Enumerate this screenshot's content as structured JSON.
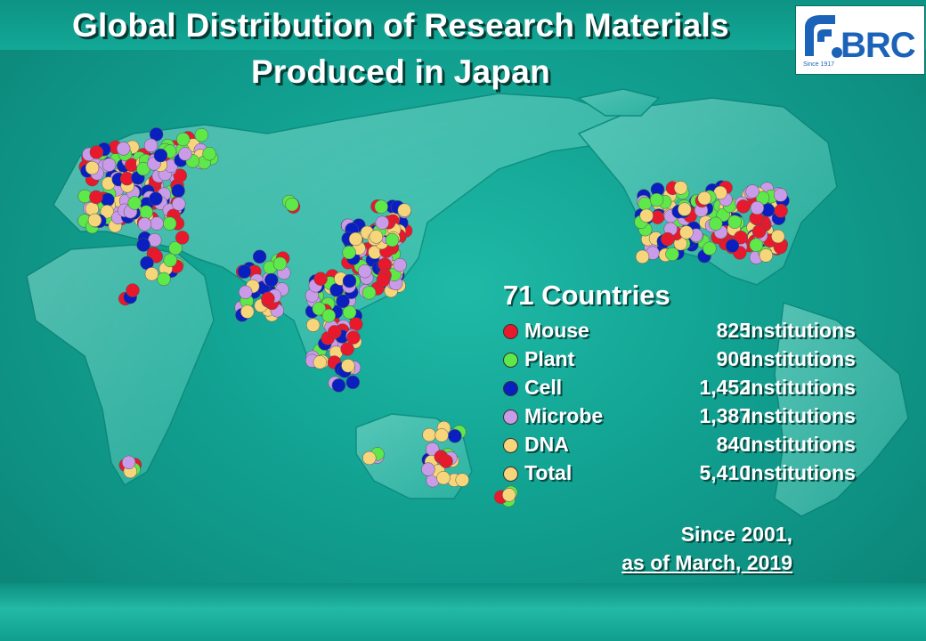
{
  "title": {
    "line1": "Global Distribution of Research Materials",
    "line2": "Produced in Japan"
  },
  "logo": {
    "text": "BRC",
    "since": "Since 1917"
  },
  "legend": {
    "countries": "71 Countries",
    "unit": "Institutions",
    "items": [
      {
        "label": "Mouse",
        "count": "825",
        "color": "#e8192c"
      },
      {
        "label": "Plant",
        "count": "906",
        "color": "#5ee84a"
      },
      {
        "label": "Cell",
        "count": "1,452",
        "color": "#0a1fbf"
      },
      {
        "label": "Microbe",
        "count": "1,387",
        "color": "#c99be8"
      },
      {
        "label": "DNA",
        "count": "840",
        "color": "#f7d57a"
      },
      {
        "label": "Total",
        "count": "5,410",
        "color": "#f7d57a"
      }
    ]
  },
  "footnote": {
    "line1": "Since 2001,",
    "line2": "as of March, 2019"
  }
}
